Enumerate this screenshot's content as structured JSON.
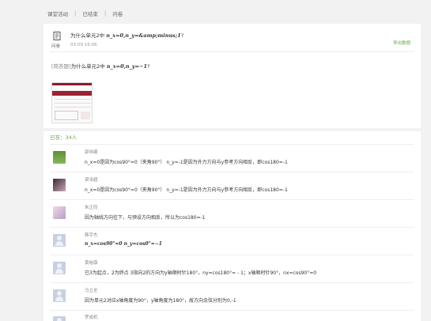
{
  "breadcrumb": {
    "items": [
      "课堂活动",
      "已结束",
      "问卷"
    ],
    "separator": "|"
  },
  "question": {
    "icon": "questionnaire-icon",
    "type_label": "问卷",
    "title_prefix": "为什么单元2中 ",
    "title_math": "n_x=0,n_y=&amp;minus;1",
    "title_suffix": "?",
    "time": "03-09 16:06",
    "export_label": "导出数据",
    "desc_tag": "[简答题]",
    "desc_prefix": "为什么单元2中 ",
    "desc_math": "n_x=0,n_y=−1",
    "desc_suffix": "?"
  },
  "answers": {
    "count_label": "已答：34人",
    "items": [
      {
        "name": "郭炜健",
        "text": "n_x=0是因为cos90°=0（夹角90°） n_y=-1是因为外力方向与y参考方向相反，即cos180=-1",
        "avatar": "green"
      },
      {
        "name": "梁泽超",
        "text": "n_x=0是因为cos90°=0（夹角90°） n_y=-1是因为外力方向与y参考方向相反，即cos180=-1",
        "avatar": "anime1"
      },
      {
        "name": "朱正同",
        "text": "因为轴线方向往下，与预设方向相反，所以为cos180=-1",
        "avatar": "anime2"
      },
      {
        "name": "韩宇杰",
        "text_math": "n_x=cos90°=0  n_y=cos0°=−1",
        "avatar": "gray"
      },
      {
        "name": "黄裕康",
        "text": "已3为起点，2为终点 3指向2的方向为y轴顺时针180°，ny=cos180°= - 1；x轴顺时针90°，nx=cos90°=0",
        "avatar": "gray"
      },
      {
        "name": "马立全",
        "text": "因为单元2对应x轴角度为90°，y轴角度为180°，故方向余弦分别为0,-1",
        "avatar": "gray"
      },
      {
        "name": "罗成机",
        "text": "",
        "avatar": "gray"
      }
    ]
  },
  "colors": {
    "accent_green": "#6aa84f",
    "background": "#f2f2f2"
  }
}
